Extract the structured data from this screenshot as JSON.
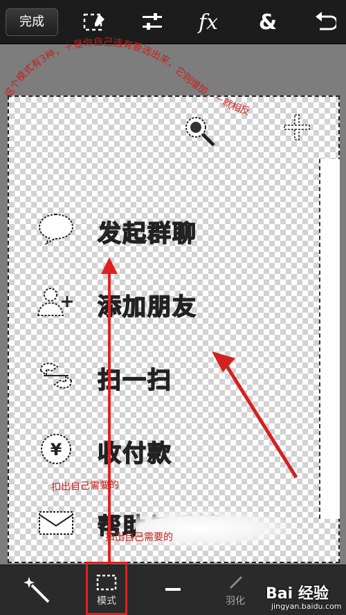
{
  "toolbar": {
    "done_label": "完成",
    "icons": [
      "selection-icon",
      "adjust-icon",
      "fx-icon",
      "ampersand-icon",
      "undo-icon"
    ],
    "fx_label": "fx",
    "amp_label": "&"
  },
  "menu": {
    "items": [
      {
        "label": "发起群聊",
        "icon": "chat-bubble-icon"
      },
      {
        "label": "添加朋友",
        "icon": "add-friend-icon"
      },
      {
        "label": "扫一扫",
        "icon": "scan-icon"
      },
      {
        "label": "收付款",
        "icon": "yuan-icon"
      },
      {
        "label": "帮助与反馈",
        "icon": "mail-icon"
      }
    ]
  },
  "annotations": {
    "arc_text": "这个模式有3种，＋是你自己选有要选出来，它则增加，－就相反",
    "note_select": "扣出自己需要的",
    "note_select_dup": "扣出自己需要的"
  },
  "bottom": {
    "tools": [
      {
        "icon": "magic-wand-icon",
        "label": ""
      },
      {
        "icon": "selection-mode-icon",
        "label": "模式"
      },
      {
        "icon": "minus-icon",
        "label": ""
      },
      {
        "icon": "brush-icon",
        "label": "羽化"
      }
    ]
  },
  "watermark": {
    "brand": "Bai 经验",
    "url": "jingyan.baidu.com"
  },
  "colors": {
    "annotation": "#c8201a",
    "highlight_box": "#e02020"
  }
}
